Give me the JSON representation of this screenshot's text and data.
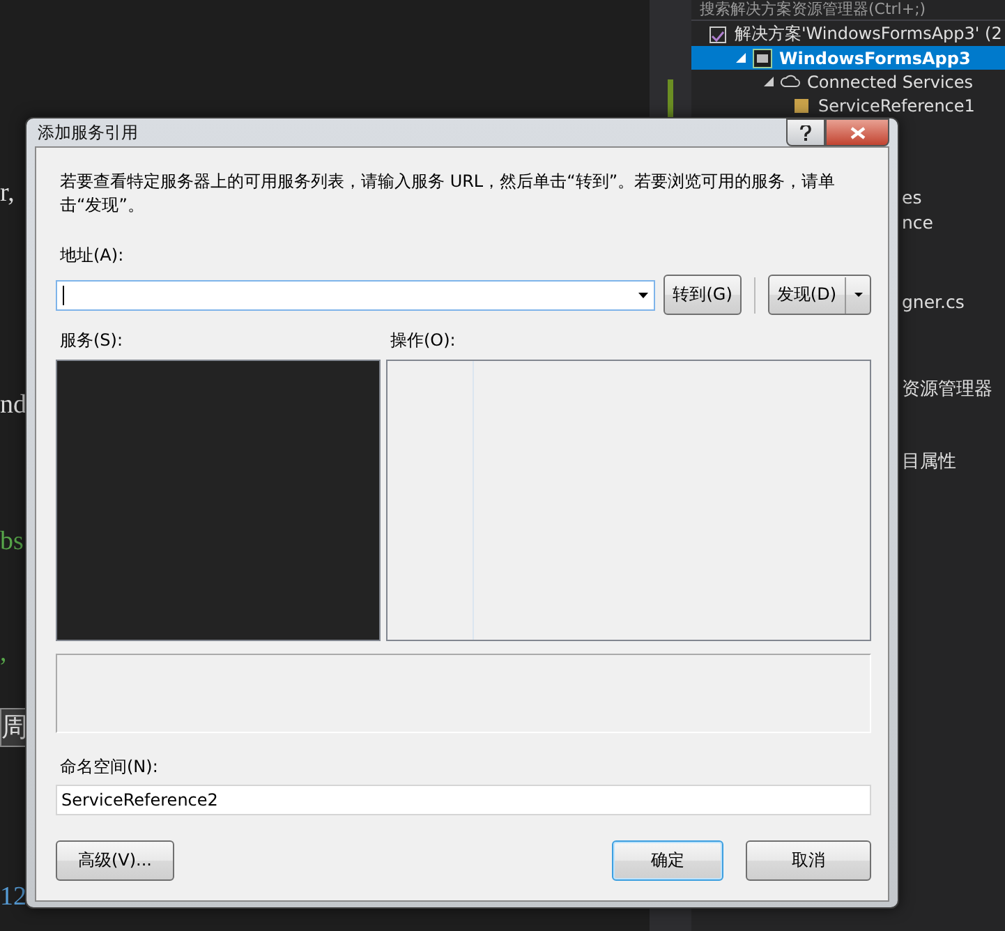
{
  "ide": {
    "editor_fragments": [
      {
        "text": "r,",
        "kind": "plain"
      },
      {
        "text": "nd",
        "kind": "plain"
      },
      {
        "text": "bs",
        "kind": "string"
      },
      {
        "text": ",",
        "kind": "string"
      },
      {
        "text": "周",
        "kind": "boxed"
      },
      {
        "text": "12",
        "kind": "number"
      }
    ],
    "solution_explorer": {
      "search_placeholder": "搜索解决方案资源管理器(Ctrl+;)",
      "items": [
        {
          "label": "解决方案'WindowsFormsApp3' (2",
          "kind": "solution",
          "selected": false,
          "children": [
            {
              "label": "WindowsFormsApp3",
              "kind": "project",
              "selected": true,
              "expanded": true,
              "children": [
                {
                  "label": "Connected Services",
                  "kind": "services",
                  "selected": false,
                  "expanded": true,
                  "children": [
                    {
                      "label": "ServiceReference1",
                      "kind": "reference",
                      "selected": false
                    }
                  ]
                }
              ]
            }
          ]
        }
      ],
      "partial_labels": [
        {
          "text": "es",
          "kind": "item"
        },
        {
          "text": "nce",
          "kind": "item"
        },
        {
          "text": "gner.cs",
          "kind": "item"
        },
        {
          "text": "资源管理器",
          "kind": "tab"
        },
        {
          "text": "目属性",
          "kind": "tab"
        }
      ]
    }
  },
  "dialog": {
    "title": "添加服务引用",
    "description": "若要查看特定服务器上的可用服务列表，请输入服务 URL，然后单击“转到”。若要浏览可用的服务，请单击“发现”。",
    "address_label": "地址(A):",
    "go_button": "转到(G)",
    "discover_button": "发现(D)",
    "services_label": "服务(S):",
    "operations_label": "操作(O):",
    "namespace_label": "命名空间(N):",
    "namespace_value": "ServiceReference2",
    "buttons": [
      {
        "label": "高级(V)...",
        "focused": false
      },
      {
        "label": "确定",
        "focused": true
      },
      {
        "label": "取消",
        "focused": false
      }
    ]
  }
}
